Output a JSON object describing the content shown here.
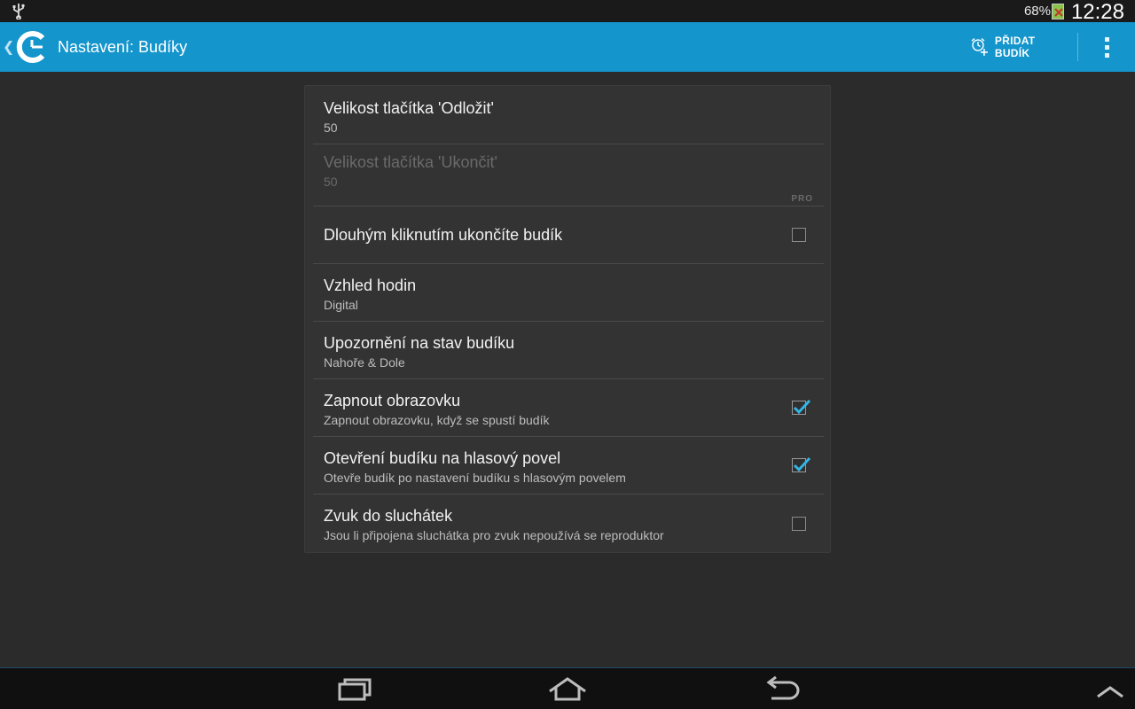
{
  "statusbar": {
    "battery": "68%",
    "time": "12:28",
    "icons": [
      "usb-icon",
      "battery-icon"
    ]
  },
  "actionbar": {
    "title": "Nastavení: Budíky",
    "add_alarm_label": "PŘIDAT BUDÍK",
    "icons": [
      "back-chevron-icon",
      "app-logo-icon",
      "add-alarm-icon",
      "overflow-menu-icon"
    ]
  },
  "colors": {
    "actionbar": "#1495cc",
    "background": "#2b2b2b",
    "card": "#333333",
    "checkmark": "#33b5e5"
  },
  "settings": [
    {
      "title": "Velikost tlačítka 'Odložit'",
      "subtitle": "50",
      "enabled": true
    },
    {
      "title": "Velikost tlačítka 'Ukončit'",
      "subtitle": "50",
      "enabled": false,
      "badge": "PRO"
    },
    {
      "title": "Dlouhým kliknutím ukončíte budík",
      "checkbox": false
    },
    {
      "title": "Vzhled hodin",
      "subtitle": "Digital"
    },
    {
      "title": "Upozornění na stav budíku",
      "subtitle": "Nahoře & Dole"
    },
    {
      "title": "Zapnout obrazovku",
      "subtitle": "Zapnout obrazovku, když se spustí budík",
      "checkbox": true
    },
    {
      "title": "Otevření budíku na hlasový povel",
      "subtitle": "Otevře budík po nastavení budíku s hlasovým povelem",
      "checkbox": true
    },
    {
      "title": "Zvuk do sluchátek",
      "subtitle": "Jsou li připojena sluchátka pro zvuk nepoužívá se reproduktor",
      "checkbox": false
    }
  ],
  "navbar": {
    "icons": [
      "recent-apps-icon",
      "home-icon",
      "back-icon",
      "collapse-up-icon"
    ]
  }
}
